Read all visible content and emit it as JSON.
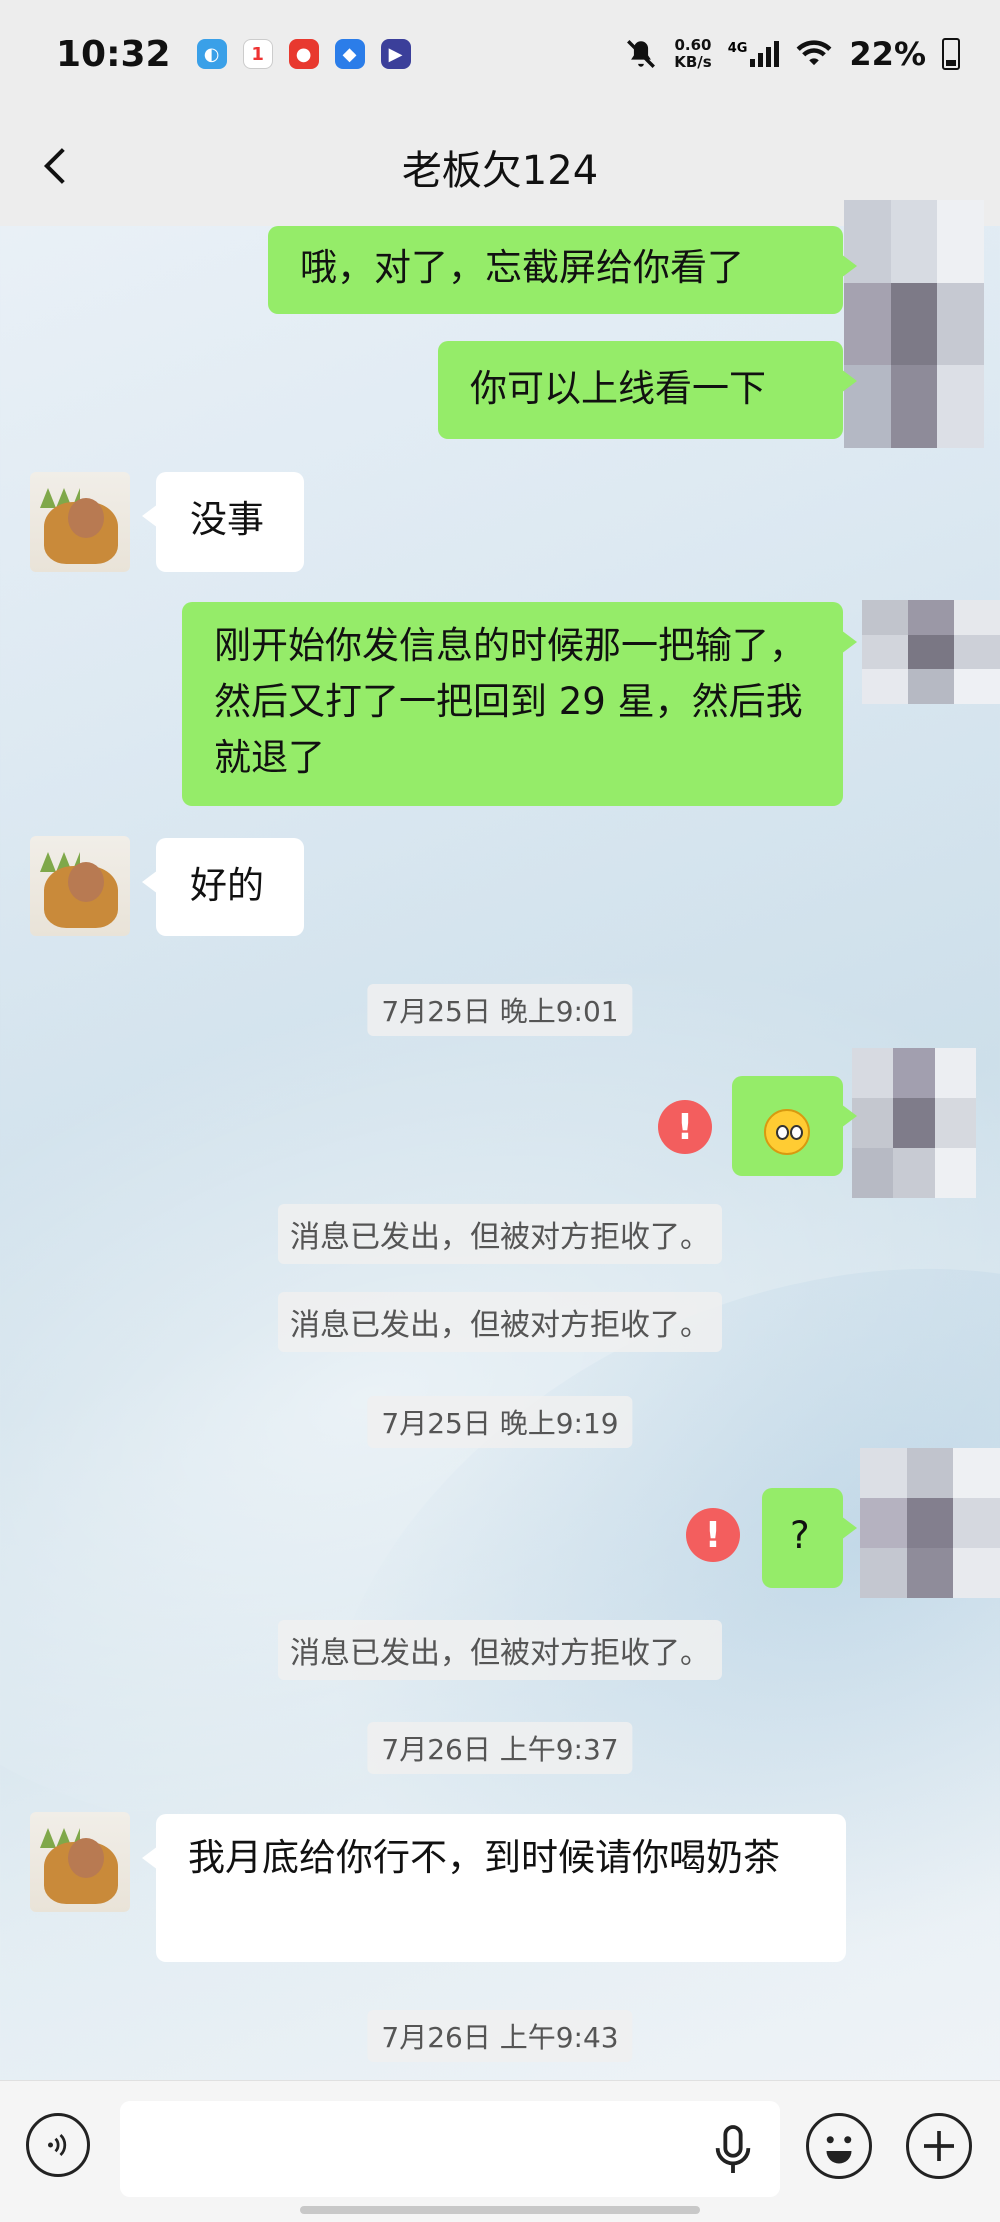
{
  "status_bar": {
    "time": "10:32",
    "net_speed_value": "0.60",
    "net_speed_unit": "KB/s",
    "network_type": "4G",
    "battery_percent": "22%",
    "app_badge": "1"
  },
  "header": {
    "title": "老板欠124"
  },
  "messages": [
    {
      "sender": "me",
      "text": "哦，对了，忘截屏给你看了"
    },
    {
      "sender": "me",
      "text": "你可以上线看一下"
    },
    {
      "sender": "them",
      "text": "没事"
    },
    {
      "sender": "me",
      "text": "刚开始你发信息的时候那一把输了，然后又打了一把回到 29 星，然后我就退了"
    },
    {
      "sender": "them",
      "text": "好的"
    },
    {
      "type": "time",
      "text": "7月25日 晚上9:01"
    },
    {
      "sender": "me",
      "type": "emoji",
      "emoji": "crying-face",
      "failed": true
    },
    {
      "type": "system",
      "text": "消息已发出，但被对方拒收了。"
    },
    {
      "type": "system",
      "text": "消息已发出，但被对方拒收了。"
    },
    {
      "type": "time",
      "text": "7月25日 晚上9:19"
    },
    {
      "sender": "me",
      "text": "?",
      "failed": true
    },
    {
      "type": "system",
      "text": "消息已发出，但被对方拒收了。"
    },
    {
      "type": "time",
      "text": "7月26日 上午9:37"
    },
    {
      "sender": "them",
      "text": "我月底给你行不，到时候请你喝奶茶"
    },
    {
      "type": "time",
      "text": "7月26日 上午9:43"
    }
  ],
  "input_bar": {
    "placeholder": ""
  },
  "colors": {
    "my_bubble": "#95ec69",
    "their_bubble": "#ffffff",
    "error_icon": "#f35e5e",
    "header_bg": "#ededed"
  }
}
